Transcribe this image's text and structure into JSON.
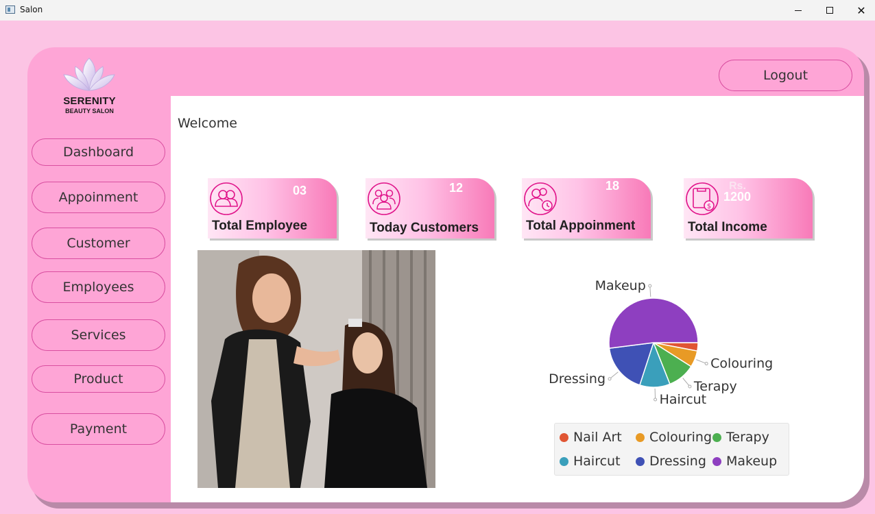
{
  "window": {
    "title": "Salon",
    "close_glyph": "✕"
  },
  "logo": {
    "name": "SERENITY",
    "subtitle": "BEAUTY SALON"
  },
  "sidebar": {
    "items": [
      {
        "label": "Dashboard"
      },
      {
        "label": "Appoinment"
      },
      {
        "label": "Customer"
      },
      {
        "label": "Employees"
      },
      {
        "label": "Services"
      },
      {
        "label": "Product"
      },
      {
        "label": "Payment"
      }
    ]
  },
  "header": {
    "logout_label": "Logout"
  },
  "main": {
    "welcome": "Welcome",
    "stats": [
      {
        "label": "Total Employee",
        "value": "03",
        "icon": "employees-icon"
      },
      {
        "label": "Today Customers",
        "value": "12",
        "icon": "customers-icon"
      },
      {
        "label": "Total Appoinment",
        "value": "18",
        "icon": "appointment-icon"
      },
      {
        "label": "Total Income",
        "value_prefix": "Rs.",
        "value": "1200",
        "icon": "income-icon"
      }
    ],
    "photo": {
      "subject": "hairdresser styling a client's hair"
    }
  },
  "colors": {
    "background": "#fcc4e4",
    "panel": "#fea5d6",
    "accent": "#d94ea0",
    "icon": "#e0148a"
  },
  "chart_data": {
    "type": "pie",
    "title": "",
    "slices": [
      {
        "name": "Nail Art",
        "value": 3,
        "color": "#e05533"
      },
      {
        "name": "Colouring",
        "value": 6,
        "color": "#e89a25"
      },
      {
        "name": "Terapy",
        "value": 10,
        "color": "#4caf50"
      },
      {
        "name": "Haircut",
        "value": 11,
        "color": "#3a9fbb"
      },
      {
        "name": "Dressing",
        "value": 18,
        "color": "#3f51b5"
      },
      {
        "name": "Makeup",
        "value": 52,
        "color": "#8e3fc0"
      }
    ],
    "legend_position": "bottom"
  }
}
